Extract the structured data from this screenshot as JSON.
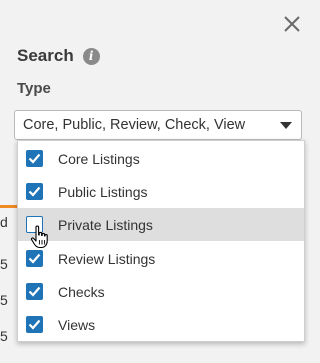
{
  "panel": {
    "title": "Search",
    "info_icon_glyph": "i",
    "type_label": "Type",
    "selected_value": "Core, Public, Review, Check, View"
  },
  "options": [
    {
      "label": "Core Listings",
      "checked": true
    },
    {
      "label": "Public Listings",
      "checked": true
    },
    {
      "label": "Private Listings",
      "checked": false
    },
    {
      "label": "Review Listings",
      "checked": true
    },
    {
      "label": "Checks",
      "checked": true
    },
    {
      "label": "Views",
      "checked": true
    }
  ],
  "background_fragments": [
    "d",
    "5",
    "5",
    "5"
  ],
  "colors": {
    "accent": "#1f73b7",
    "hover_row": "#dedede",
    "orange_accent": "#f08a24",
    "background": "#f2f2f2"
  },
  "icons": {
    "close": "close-icon",
    "info": "info-icon",
    "caret": "chevron-down-icon",
    "checkbox_checked": "checkbox-checked-icon",
    "checkbox_unchecked": "checkbox-unchecked-icon",
    "cursor": "hand-pointer-cursor-icon"
  }
}
